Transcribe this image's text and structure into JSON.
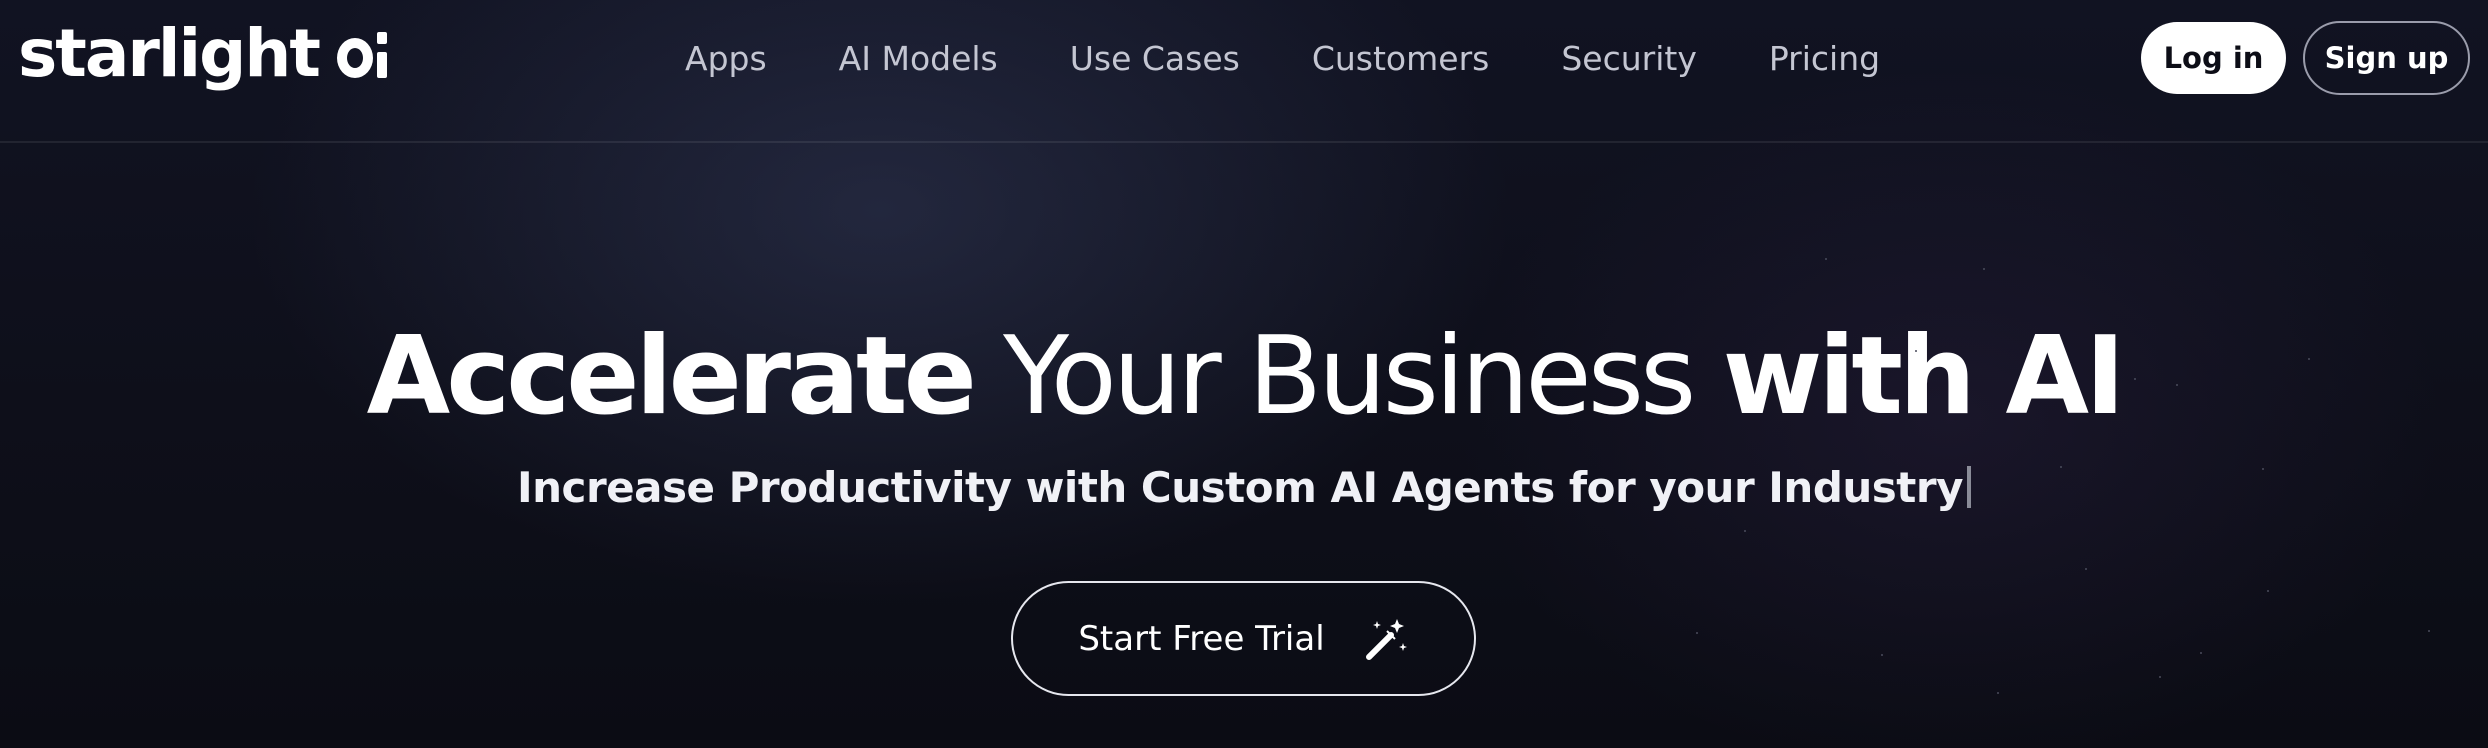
{
  "brand": {
    "logo_text": "starlight ai"
  },
  "nav": {
    "links": [
      {
        "label": "Apps"
      },
      {
        "label": "AI Models"
      },
      {
        "label": "Use Cases"
      },
      {
        "label": "Customers"
      },
      {
        "label": "Security"
      },
      {
        "label": "Pricing"
      }
    ]
  },
  "auth": {
    "login_label": "Log in",
    "signup_label": "Sign up"
  },
  "hero": {
    "title_part1": "Accelerate",
    "title_part2": " Your Business ",
    "title_part3": "with AI",
    "subtitle": "Increase Productivity with Custom AI Agents for your Industry",
    "cta_label": "Start Free Trial",
    "cta_icon": "magic-wand-icon"
  },
  "colors": {
    "background": "#0c0d16",
    "text_primary": "#ffffff",
    "nav_text": "#c4c6d2",
    "login_bg": "#ffffff"
  }
}
